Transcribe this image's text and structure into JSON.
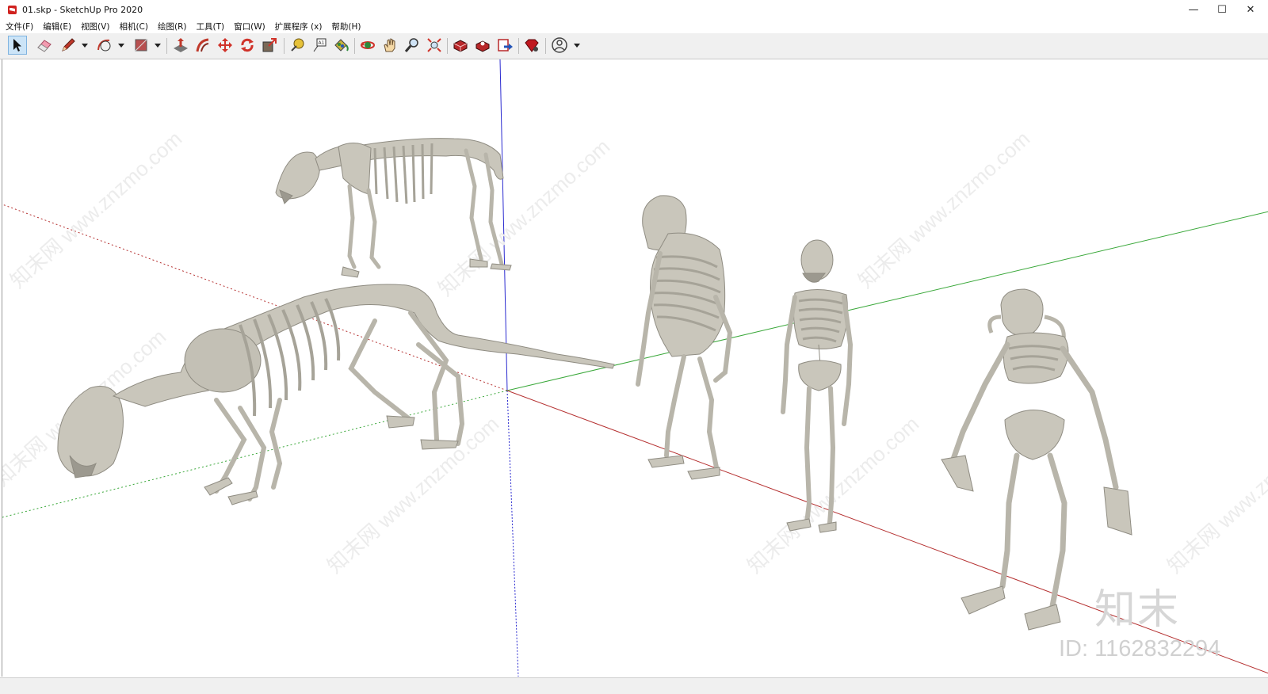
{
  "window": {
    "title": "01.skp - SketchUp Pro 2020",
    "minimize": "—",
    "maximize": "☐",
    "close": "✕"
  },
  "menu": [
    {
      "label": "文件(F)"
    },
    {
      "label": "编辑(E)"
    },
    {
      "label": "视图(V)"
    },
    {
      "label": "相机(C)"
    },
    {
      "label": "绘图(R)"
    },
    {
      "label": "工具(T)"
    },
    {
      "label": "窗口(W)"
    },
    {
      "label": "扩展程序 (x)"
    },
    {
      "label": "帮助(H)"
    }
  ],
  "toolbar": {
    "tools": [
      {
        "name": "select-tool-icon",
        "active": true
      },
      {
        "name": "eraser-tool-icon"
      },
      {
        "name": "pencil-line-tool-icon",
        "dropdown": true
      },
      {
        "name": "arc-tool-icon",
        "dropdown": true
      },
      {
        "name": "rectangle-tool-icon",
        "dropdown": true
      },
      {
        "name": "push-pull-tool-icon"
      },
      {
        "name": "offset-tool-icon"
      },
      {
        "name": "move-tool-icon"
      },
      {
        "name": "rotate-tool-icon"
      },
      {
        "name": "scale-tool-icon"
      },
      {
        "name": "tape-measure-tool-icon"
      },
      {
        "name": "text-tool-icon"
      },
      {
        "name": "paint-bucket-tool-icon"
      },
      {
        "name": "orbit-tool-icon"
      },
      {
        "name": "pan-tool-icon"
      },
      {
        "name": "zoom-tool-icon"
      },
      {
        "name": "zoom-extents-tool-icon"
      },
      {
        "name": "3d-warehouse-icon"
      },
      {
        "name": "extension-warehouse-icon"
      },
      {
        "name": "layout-send-icon"
      },
      {
        "name": "ruby-console-icon"
      },
      {
        "name": "account-icon",
        "dropdown": true
      }
    ]
  },
  "watermark": {
    "logo_text": "知末",
    "id_text": "ID: 1162832294",
    "diagonal_text": "知末网 www.znzmo.com"
  },
  "colors": {
    "axis_blue": "#2b2bd0",
    "axis_green": "#3aa83a",
    "axis_red": "#b53030",
    "bone": "#c9c6bb",
    "bone_shadow": "#9c998f"
  }
}
